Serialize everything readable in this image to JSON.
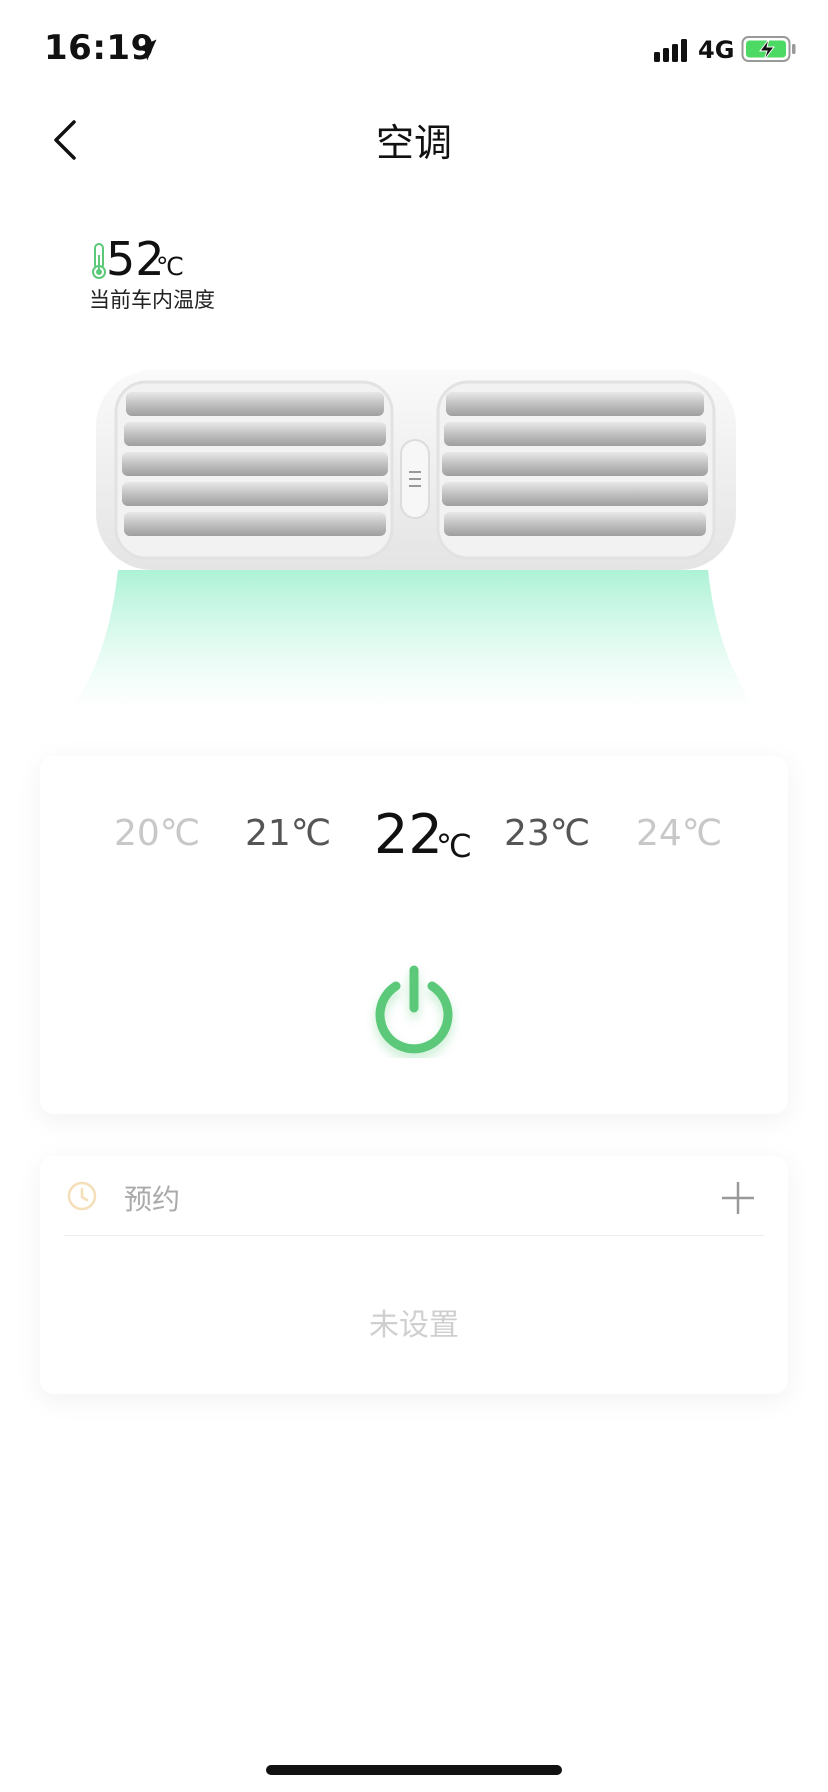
{
  "status_bar": {
    "time": "16:19",
    "network": "4G",
    "icons": [
      "location-arrow-icon",
      "signal-icon",
      "battery-charging-icon"
    ]
  },
  "header": {
    "title": "空调",
    "back_icon": "chevron-left-icon"
  },
  "current": {
    "temp": "52",
    "unit": "℃",
    "label": "当前车内温度",
    "icon": "thermometer-icon"
  },
  "temperature_options": [
    {
      "value": "20℃",
      "state": "faded"
    },
    {
      "value": "21℃",
      "state": "near"
    },
    {
      "value": "22",
      "unit": "℃",
      "state": "selected"
    },
    {
      "value": "23℃",
      "state": "near"
    },
    {
      "value": "24℃",
      "state": "faded"
    }
  ],
  "power": {
    "icon": "power-icon",
    "color": "#5cc97a"
  },
  "schedule": {
    "label": "预约",
    "empty_text": "未设置",
    "icons": [
      "clock-icon",
      "plus-icon"
    ]
  },
  "colors": {
    "accent": "#5cc97a",
    "airflow": "#b8f5dc"
  }
}
